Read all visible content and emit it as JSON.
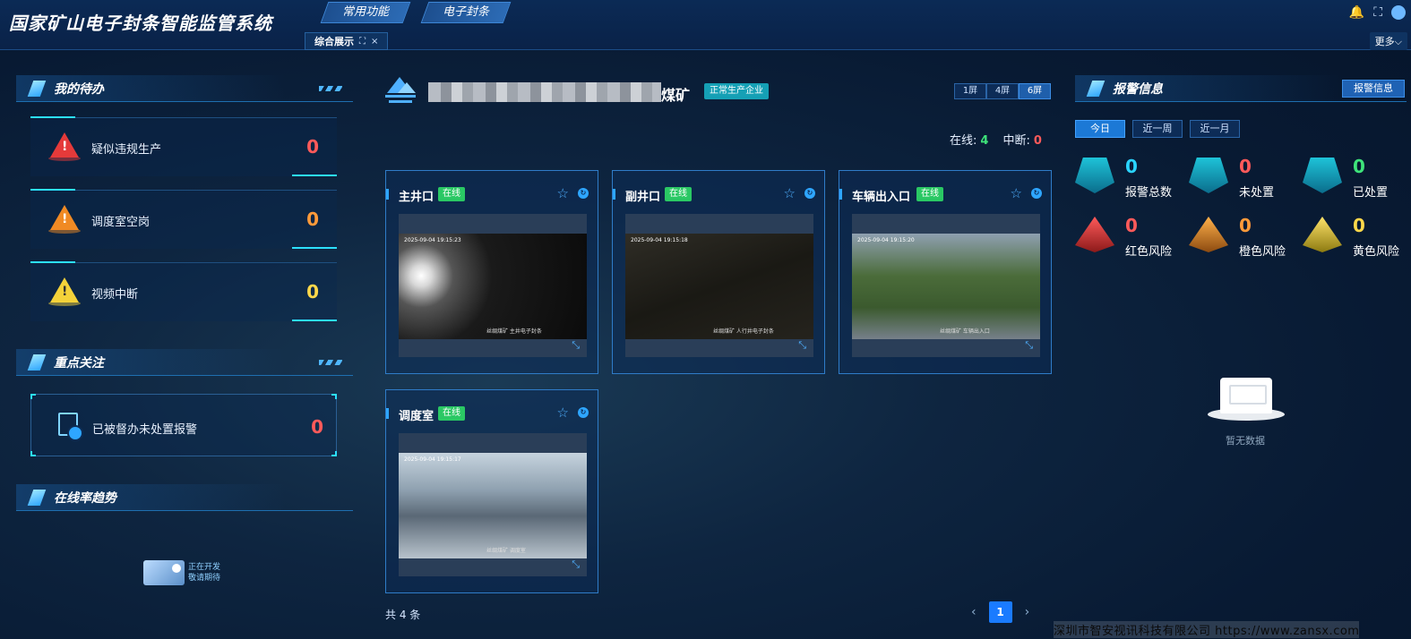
{
  "header": {
    "app_title": "国家矿山电子封条智能监管系统",
    "nav_tabs": [
      "常用功能",
      "电子封条"
    ],
    "open_tab": {
      "label": "综合展示",
      "expand_glyph": "⛶",
      "close_glyph": "×"
    },
    "more_label": "更多",
    "icons": [
      "bell-icon",
      "fullscreen-icon",
      "avatar"
    ]
  },
  "left": {
    "todo_title": "我的待办",
    "todo_items": [
      {
        "label": "疑似违规生产",
        "value": "0",
        "level": "red"
      },
      {
        "label": "调度室空岗",
        "value": "0",
        "level": "orange"
      },
      {
        "label": "视频中断",
        "value": "0",
        "level": "yellow"
      }
    ],
    "focus_title": "重点关注",
    "focus_item": {
      "label": "已被督办未处置报警",
      "value": "0"
    },
    "trend_title": "在线率趋势",
    "dev_notice": [
      "正在开发",
      "敬请期待"
    ]
  },
  "middle": {
    "mine_name": "煤矿",
    "mine_status_badge": "正常生产企业",
    "screen_options": [
      "1屏",
      "4屏",
      "6屏"
    ],
    "screen_selected": "6屏",
    "online_label": "在线:",
    "online_value": "4",
    "offline_label": "中断:",
    "offline_value": "0",
    "cameras": [
      {
        "name": "主井口",
        "status": "在线",
        "timestamp": "2025-09-04 19:15:23",
        "watermark": "丝绸煤矿  主井电子封条"
      },
      {
        "name": "副井口",
        "status": "在线",
        "timestamp": "2025-09-04 19:15:18",
        "watermark": "丝绸煤矿  人行井电子封条"
      },
      {
        "name": "车辆出入口",
        "status": "在线",
        "timestamp": "2025-09-04 19:15:20",
        "watermark": "丝绸煤矿  车辆出入口"
      },
      {
        "name": "调度室",
        "status": "在线",
        "timestamp": "2025-09-04 19:15:17",
        "watermark": "丝绸煤矿  调度室"
      }
    ],
    "total_label": "共 4 条",
    "current_page": "1"
  },
  "right": {
    "title": "报警信息",
    "alarm_info_button": "报警信息",
    "periods": [
      "今日",
      "近一周",
      "近一月"
    ],
    "period_selected": "今日",
    "stats": [
      {
        "label": "报警总数",
        "value": "0",
        "color": "cyan",
        "icon": "alarm-light-icon"
      },
      {
        "label": "未处置",
        "value": "0",
        "color": "red",
        "icon": "pending-doc-icon"
      },
      {
        "label": "已处置",
        "value": "0",
        "color": "green",
        "icon": "done-doc-icon"
      },
      {
        "label": "红色风险",
        "value": "0",
        "color": "red",
        "icon": "red-warning-icon"
      },
      {
        "label": "橙色风险",
        "value": "0",
        "color": "orange",
        "icon": "orange-warning-icon"
      },
      {
        "label": "黄色风险",
        "value": "0",
        "color": "yellow",
        "icon": "yellow-warning-icon"
      }
    ],
    "empty_text": "暂无数据"
  },
  "footer_watermark": "深圳市智安视讯科技有限公司  https://www.zansx.com",
  "colors": {
    "online": "#3ee37a",
    "danger": "#ff5a5a",
    "accent": "#2ea6ff",
    "badge_teal": "#15a0b5"
  }
}
